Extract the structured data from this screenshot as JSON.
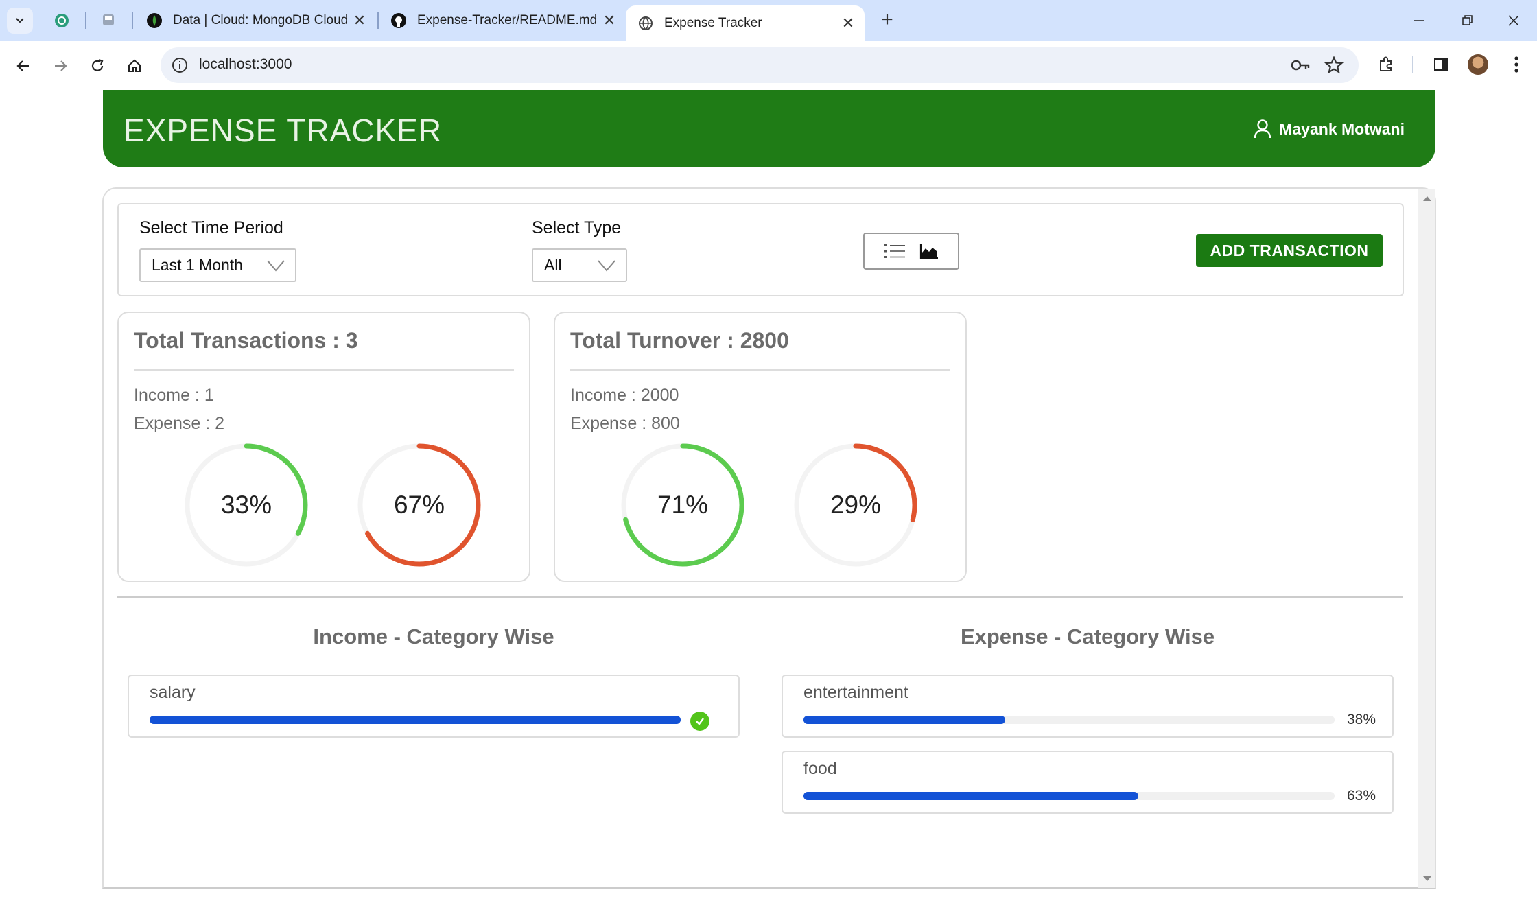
{
  "browser": {
    "tabs": [
      {
        "title": "Data | Cloud: MongoDB Cloud"
      },
      {
        "title": "Expense-Tracker/README.md a"
      },
      {
        "title": "Expense Tracker"
      }
    ],
    "url": "localhost:3000"
  },
  "header": {
    "title": "EXPENSE TRACKER",
    "user": "Mayank Motwani"
  },
  "filters": {
    "period_label": "Select Time Period",
    "period_value": "Last 1 Month",
    "type_label": "Select Type",
    "type_value": "All",
    "add_button": "ADD TRANSACTION"
  },
  "transactions": {
    "title": "Total Transactions : 3",
    "income": "Income : 1",
    "expense": "Expense : 2",
    "income_pct_label": "33%",
    "expense_pct_label": "67%",
    "income_pct": 33,
    "expense_pct": 67
  },
  "turnover": {
    "title": "Total Turnover : 2800",
    "income": "Income : 2000",
    "expense": "Expense : 800",
    "income_pct_label": "71%",
    "expense_pct_label": "29%",
    "income_pct": 71,
    "expense_pct": 29
  },
  "income_category": {
    "title": "Income - Category Wise",
    "items": [
      {
        "name": "salary",
        "pct": 100
      }
    ]
  },
  "expense_category": {
    "title": "Expense - Category Wise",
    "items": [
      {
        "name": "entertainment",
        "pct": 38,
        "pct_label": "38%"
      },
      {
        "name": "food",
        "pct": 63,
        "pct_label": "63%"
      }
    ]
  },
  "colors": {
    "header_green": "#1f7c16",
    "income_ring": "#5ccb4f",
    "expense_ring": "#e0542e",
    "progress_blue": "#1352d6"
  },
  "icons": {
    "list_view": "list-icon",
    "chart_view": "area-chart-icon",
    "user": "user-icon"
  }
}
